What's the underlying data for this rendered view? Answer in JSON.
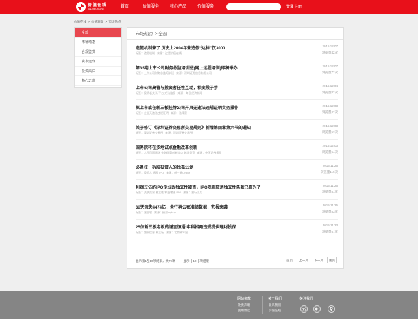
{
  "header": {
    "logo_cn": "价值在线",
    "logo_en": "VALUEONLINE",
    "nav": [
      "首页",
      "价值服务",
      "核心产品",
      "价值服务"
    ],
    "search": {
      "value": "",
      "placeholder": ""
    },
    "login": "登录",
    "register": "注册"
  },
  "breadcrumb": [
    "价值在线",
    ">",
    "价值观察",
    ">",
    "市场热点"
  ],
  "sidebar": {
    "items": [
      {
        "label": "全部",
        "active": true
      },
      {
        "label": "市场动态",
        "active": false
      },
      {
        "label": "合规鉴赏",
        "active": false
      },
      {
        "label": "资本运作",
        "active": false
      },
      {
        "label": "投资风口",
        "active": false
      },
      {
        "label": "静心之旅",
        "active": false
      }
    ]
  },
  "content": {
    "title": "市场热点 > 全部",
    "articles": [
      {
        "title": "造假机制来了 历史上2004年来造假“达标”仅3000",
        "tag": "标签：",
        "tag_value": "造假机制",
        "source": "来源：",
        "source_value": "这是价值在线",
        "date": "2015.12.07",
        "views": "浏览量42次"
      },
      {
        "title": "第35期上市公司财务总监培训班(网上远程培训)即将举办",
        "tag": "标签：",
        "tag_value": "上市公司财务总监培训班",
        "source": "来源：",
        "source_value": "深圳证券信息有限公司",
        "date": "2015.12.07",
        "views": "浏览量72次"
      },
      {
        "title": "上市公司高管与投资者任性互动，秒变段子手",
        "tag": "标签：",
        "tag_value": "投资者关系 平台 方法陪投",
        "source": "来源：",
        "source_value": "每日经济新闻",
        "date": "2015.12.04",
        "views": "浏览量82次"
      },
      {
        "title": "拟上市或在新三板挂牌公司开具无违法违规证明实务操作",
        "tag": "标签：",
        "tag_value": "企业无违法违规证明",
        "source": "来源：",
        "source_value": "法律家",
        "date": "2015.12.03",
        "views": "浏览量42次"
      },
      {
        "title": "关于修订《深圳证券交易所交易规则》新增第四章第六节的通知",
        "tag": "标签：",
        "tag_value": "深圳证券交易所",
        "source": "来源：",
        "source_value": "深圳证券交易所",
        "date": "2015.12.03",
        "views": "浏览量67次"
      },
      {
        "title": "国务院将在多地试点金融改革创新",
        "tag": "标签：",
        "tag_value": "人民币国际化 金融改革创新试点 跨境投资",
        "source": "来源：",
        "source_value": "中国证券报网",
        "date": "2015.12.03",
        "views": "浏览量64次"
      },
      {
        "title": "必备技：拆股投资人的独孤11剑",
        "tag": "标签：",
        "tag_value": "投资人 拆股 IPO",
        "source": "来源：",
        "source_value": "新三板Online",
        "date": "2015.11.26",
        "views": "浏览量119次"
      },
      {
        "title": "利润过亿的IPO企业因独立性被否，IPO规则取消独立性条款已直兴了",
        "tag": "标签：",
        "tag_value": "关联交易 独立性 利益输送 IPO",
        "source": "来源：",
        "source_value": "投行小兵",
        "date": "2015.11.26",
        "views": "浏览量81次"
      },
      {
        "title": "30天流失4474亿，央行再公布准绩数据，究报来袭",
        "tag": "标签：",
        "tag_value": "营业收",
        "source": "来源：",
        "source_value": "经济mybuy",
        "date": "2015.11.25",
        "views": "浏览量83次"
      },
      {
        "title": "25位新三板老板的谨言慎语 中科招商违规提供理财投保",
        "tag": "标签：",
        "tag_value": "独家信息 新三板",
        "source": "来源：",
        "source_value": "北京青年报",
        "date": "2015.11.23",
        "views": "浏览量57次"
      }
    ]
  },
  "pagination": {
    "info": "显示第1至10项结果，共79项",
    "per_page_prefix": "显示",
    "per_page_value": "10",
    "per_page_suffix": "项结果",
    "buttons": [
      "首页",
      "上一页",
      "下一页",
      "尾页"
    ]
  },
  "footer": {
    "col1_title": "网站条款",
    "col1_links": [
      "免责声明",
      "使用协议"
    ],
    "col2_title": "关于我们",
    "col2_links": [
      "联系我们",
      "价值在线"
    ],
    "col3_title": "关注我们"
  },
  "colors": {
    "brand_red": "#e8101a",
    "sidebar_active": "#e8474f",
    "footer_gray": "#858585"
  }
}
